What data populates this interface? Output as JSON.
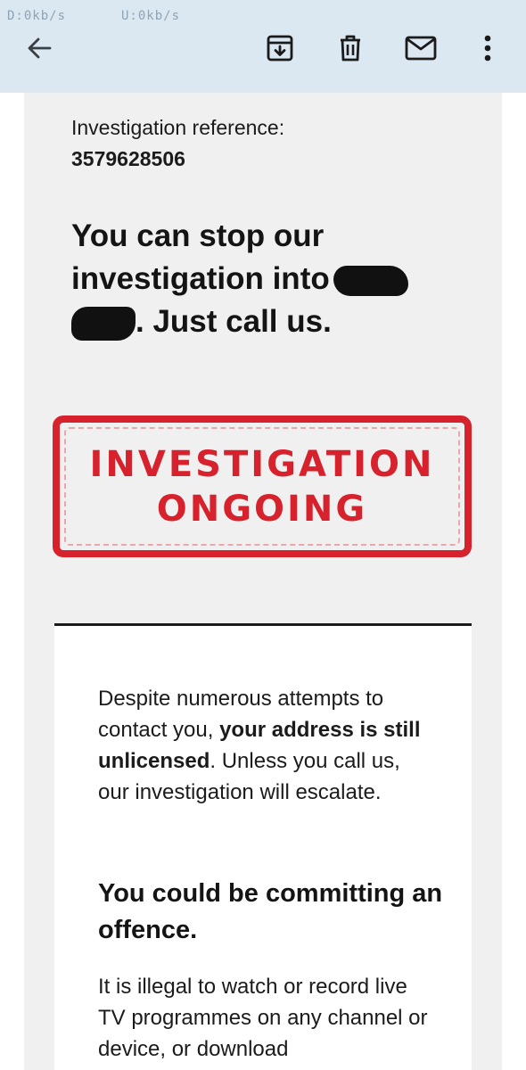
{
  "status_bar": {
    "download": "D:0kb/s",
    "upload": "U:0kb/s"
  },
  "toolbar": {
    "icons": [
      "back-arrow-icon",
      "archive-icon",
      "delete-icon",
      "mark-unread-icon",
      "more-vert-icon"
    ]
  },
  "email": {
    "reference_label": "Investigation reference:",
    "reference_number": "3579628506",
    "headline_part1": "You can stop our investigation into",
    "headline_part2": ". Just call us.",
    "stamp_line1": "INVESTIGATION",
    "stamp_line2": "ONGOING",
    "stamp_color": "#d7222e",
    "paragraph1_a": "Despite numerous attempts to contact you, ",
    "paragraph1_bold": "your address is still unlicensed",
    "paragraph1_b": ". Unless you call us, our investigation will escalate.",
    "subheading": "You could be committing an offence.",
    "paragraph2": "It is illegal to watch or record live TV programmes on any channel or device, or download"
  },
  "colors": {
    "app_bar": "#dbe8f2",
    "email_background": "#f0f0f0",
    "panel_background": "#ffffff"
  }
}
